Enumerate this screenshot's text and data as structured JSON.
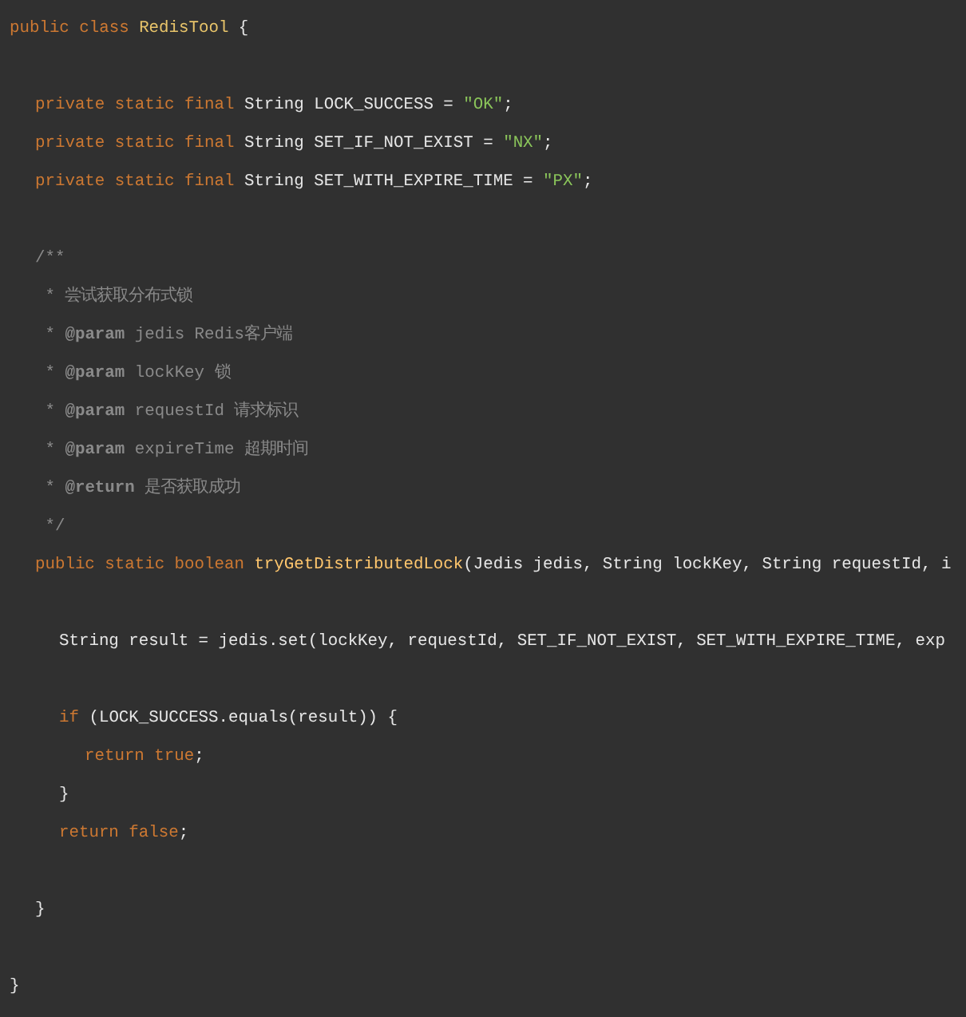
{
  "code_lines": [
    {
      "kind": "top",
      "tokens": [
        {
          "kind": "keyword",
          "text": "public class "
        },
        {
          "kind": "type_name",
          "text": "RedisTool"
        },
        {
          "kind": "plain",
          "text": " {"
        }
      ]
    },
    {
      "kind": "blank"
    },
    {
      "kind": "member",
      "tokens": [
        {
          "kind": "keyword",
          "text": "private static final "
        },
        {
          "kind": "plain",
          "text": "String LOCK_SUCCESS = "
        },
        {
          "kind": "string",
          "text": "\"OK\""
        },
        {
          "kind": "plain",
          "text": ";"
        }
      ]
    },
    {
      "kind": "member",
      "tokens": [
        {
          "kind": "keyword",
          "text": "private static final "
        },
        {
          "kind": "plain",
          "text": "String SET_IF_NOT_EXIST = "
        },
        {
          "kind": "string",
          "text": "\"NX\""
        },
        {
          "kind": "plain",
          "text": ";"
        }
      ]
    },
    {
      "kind": "member",
      "tokens": [
        {
          "kind": "keyword",
          "text": "private static final "
        },
        {
          "kind": "plain",
          "text": "String SET_WITH_EXPIRE_TIME = "
        },
        {
          "kind": "string",
          "text": "\"PX\""
        },
        {
          "kind": "plain",
          "text": ";"
        }
      ]
    },
    {
      "kind": "blank"
    },
    {
      "kind": "member",
      "tokens": [
        {
          "kind": "comment",
          "text": "/**"
        }
      ]
    },
    {
      "kind": "member",
      "tokens": [
        {
          "kind": "comment",
          "text": " * 尝试获取分布式锁"
        }
      ]
    },
    {
      "kind": "member",
      "tokens": [
        {
          "kind": "comment",
          "text": " * "
        },
        {
          "kind": "doc_tag",
          "text": "@param"
        },
        {
          "kind": "comment",
          "text": " jedis Redis客户端"
        }
      ]
    },
    {
      "kind": "member",
      "tokens": [
        {
          "kind": "comment",
          "text": " * "
        },
        {
          "kind": "doc_tag",
          "text": "@param"
        },
        {
          "kind": "comment",
          "text": " lockKey 锁"
        }
      ]
    },
    {
      "kind": "member",
      "tokens": [
        {
          "kind": "comment",
          "text": " * "
        },
        {
          "kind": "doc_tag",
          "text": "@param"
        },
        {
          "kind": "comment",
          "text": " requestId 请求标识"
        }
      ]
    },
    {
      "kind": "member",
      "tokens": [
        {
          "kind": "comment",
          "text": " * "
        },
        {
          "kind": "doc_tag",
          "text": "@param"
        },
        {
          "kind": "comment",
          "text": " expireTime 超期时间"
        }
      ]
    },
    {
      "kind": "member",
      "tokens": [
        {
          "kind": "comment",
          "text": " * "
        },
        {
          "kind": "doc_tag",
          "text": "@return"
        },
        {
          "kind": "comment",
          "text": " 是否获取成功"
        }
      ]
    },
    {
      "kind": "member",
      "tokens": [
        {
          "kind": "comment",
          "text": " */"
        }
      ]
    },
    {
      "kind": "member",
      "tokens": [
        {
          "kind": "keyword",
          "text": "public static boolean "
        },
        {
          "kind": "method_name",
          "text": "tryGetDistributedLock"
        },
        {
          "kind": "plain",
          "text": "(Jedis jedis, String lockKey, String requestId, i"
        }
      ]
    },
    {
      "kind": "blank"
    },
    {
      "kind": "body",
      "tokens": [
        {
          "kind": "plain",
          "text": "String result = jedis.set(lockKey, requestId, SET_IF_NOT_EXIST, SET_WITH_EXPIRE_TIME, exp"
        }
      ]
    },
    {
      "kind": "blank"
    },
    {
      "kind": "body",
      "tokens": [
        {
          "kind": "keyword",
          "text": "if "
        },
        {
          "kind": "plain",
          "text": "(LOCK_SUCCESS.equals(result)) {"
        }
      ]
    },
    {
      "kind": "inner",
      "tokens": [
        {
          "kind": "keyword",
          "text": "return true"
        },
        {
          "kind": "plain",
          "text": ";"
        }
      ]
    },
    {
      "kind": "body",
      "tokens": [
        {
          "kind": "plain",
          "text": "}"
        }
      ]
    },
    {
      "kind": "body",
      "tokens": [
        {
          "kind": "keyword",
          "text": "return false"
        },
        {
          "kind": "plain",
          "text": ";"
        }
      ]
    },
    {
      "kind": "blank"
    },
    {
      "kind": "member",
      "tokens": [
        {
          "kind": "plain",
          "text": "}"
        }
      ]
    },
    {
      "kind": "blank"
    },
    {
      "kind": "top",
      "tokens": [
        {
          "kind": "plain",
          "text": "}"
        }
      ]
    }
  ]
}
